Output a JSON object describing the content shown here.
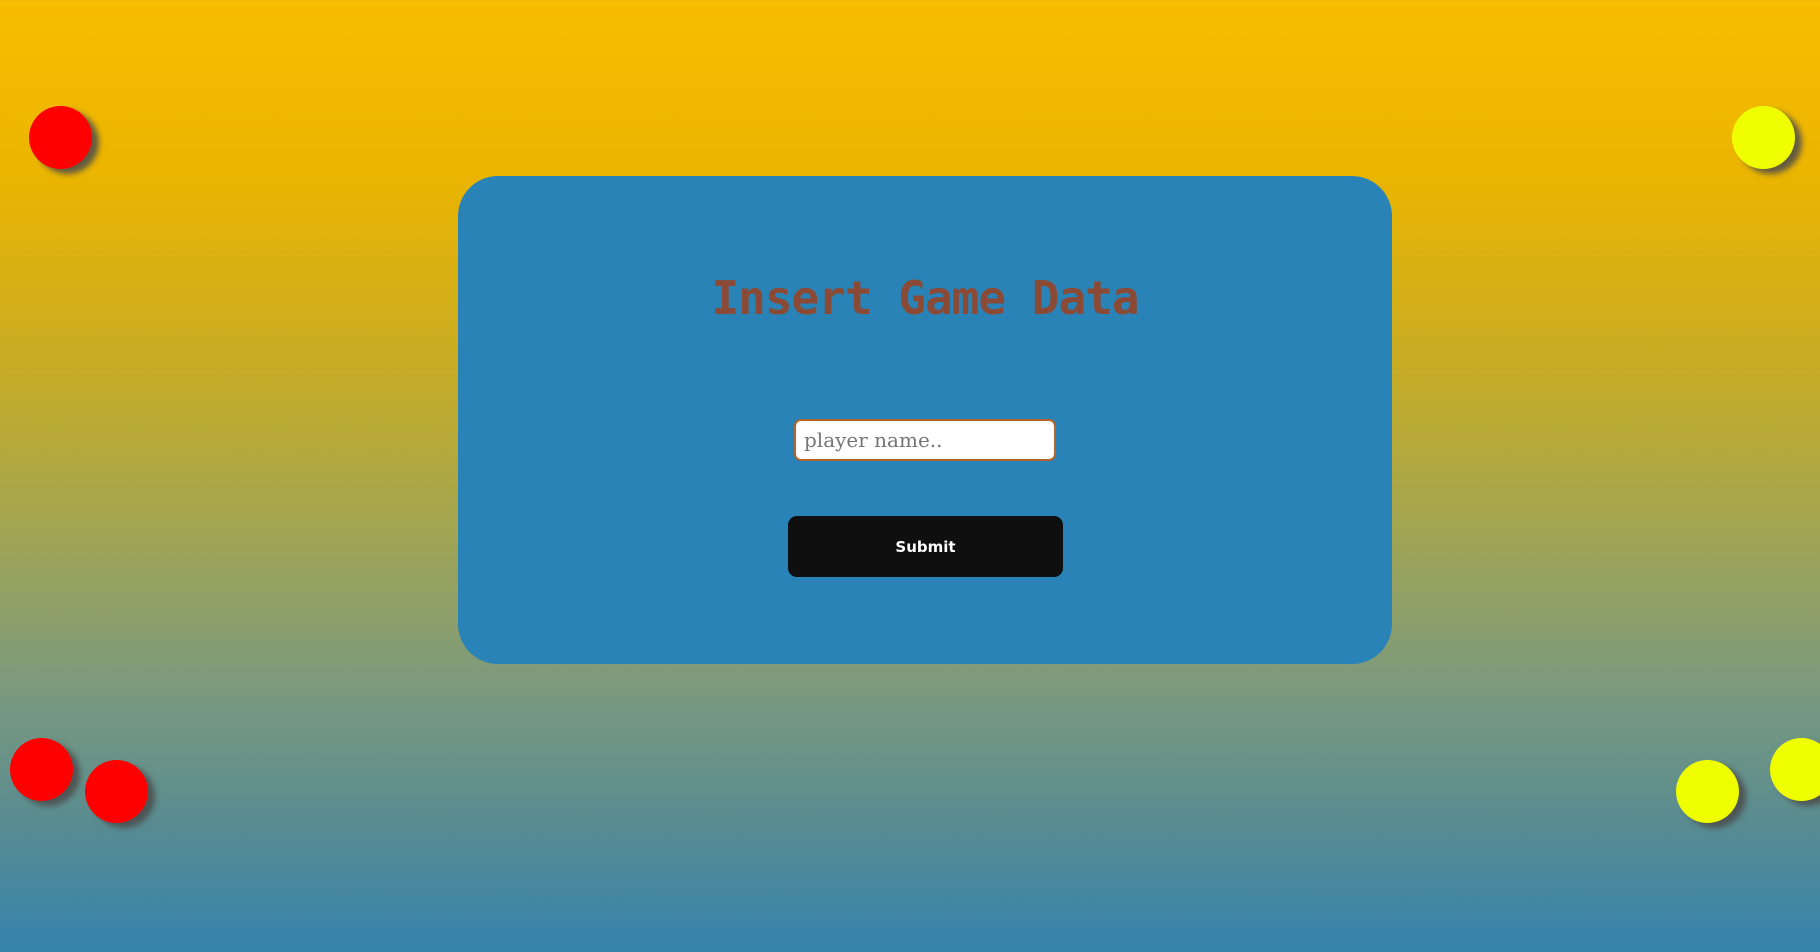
{
  "form": {
    "title": "Insert Game Data",
    "player_name_value": "",
    "player_name_placeholder": "player name..",
    "submit_label": "Submit"
  },
  "colors": {
    "panel": "#2a83b6",
    "title": "#8a4a35",
    "button": "#0f0f0f",
    "red_disc": "#ff0000",
    "yellow_disc": "#f0ff00",
    "background_top": "#f8bd00",
    "background_bottom": "#3583ad"
  }
}
